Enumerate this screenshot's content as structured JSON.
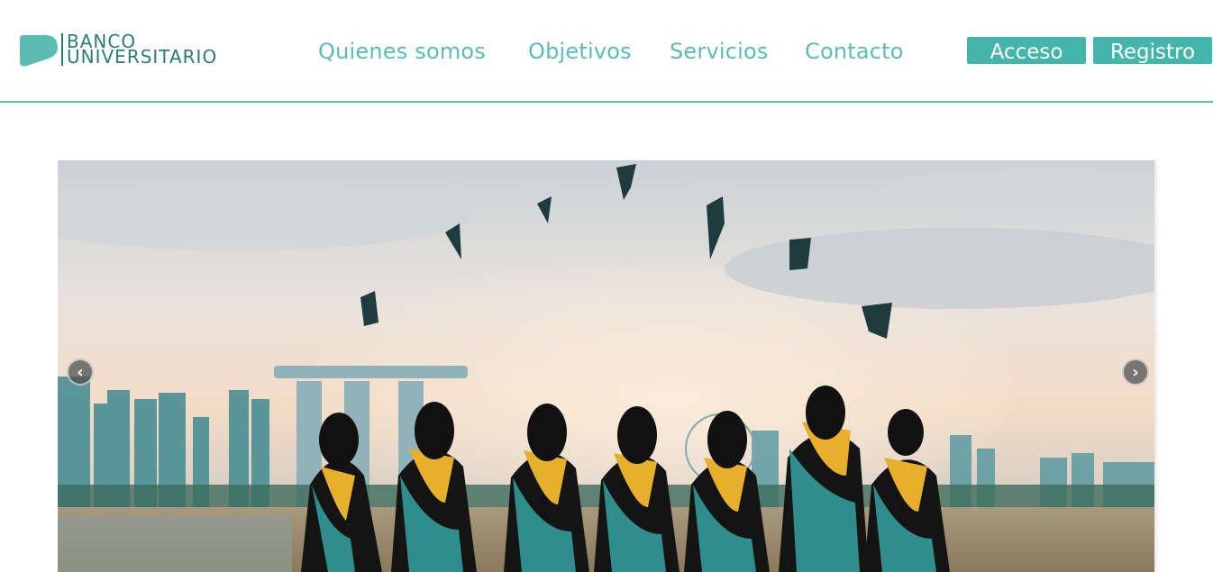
{
  "brand": {
    "line1": "BANCO",
    "line2": "UNIVERSITARIO",
    "accent": "#5bbcb3",
    "dark": "#2b7b78"
  },
  "nav": {
    "items": [
      {
        "label": "Quienes somos"
      },
      {
        "label": "Objetivos"
      },
      {
        "label": "Servicios"
      },
      {
        "label": "Contacto"
      }
    ]
  },
  "auth": {
    "login_label": "Acceso",
    "register_label": "Registro",
    "button_color": "#44b5ab"
  },
  "carousel": {
    "prev_icon": "‹",
    "next_icon": "›"
  }
}
